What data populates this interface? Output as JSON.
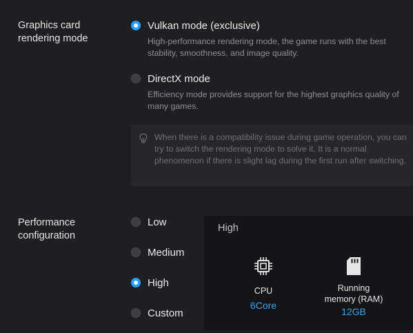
{
  "rendering": {
    "label": "Graphics card\nrendering mode",
    "options": [
      {
        "label": "Vulkan mode (exclusive)",
        "desc": "High-performance rendering mode, the game runs with the best stability, smoothness, and image quality.",
        "selected": true
      },
      {
        "label": "DirectX mode",
        "desc": "Efficiency mode provides support for the highest graphics quality of many games.",
        "selected": false
      }
    ],
    "tip": {
      "icon": "lightbulb-icon",
      "text": "When there is a compatibility issue during game operation, you can try to switch the rendering mode to solve it. It is a normal phenomenon if there is slight lag during the first run after switching."
    }
  },
  "performance": {
    "label": "Performance\nconfiguration",
    "options": [
      {
        "label": "Low",
        "selected": false
      },
      {
        "label": "Medium",
        "selected": false
      },
      {
        "label": "High",
        "selected": true
      },
      {
        "label": "Custom",
        "selected": false
      }
    ],
    "card": {
      "title": "High",
      "cpu": {
        "icon": "cpu-icon",
        "label": "CPU",
        "value": "6Core"
      },
      "ram": {
        "icon": "memory-card-icon",
        "label": "Running\nmemory (RAM)",
        "value": "12GB"
      }
    }
  },
  "colors": {
    "accent": "#2a9df4",
    "value_text": "#3aa4ee",
    "background": "#1e1f22",
    "card_background": "#141518"
  }
}
